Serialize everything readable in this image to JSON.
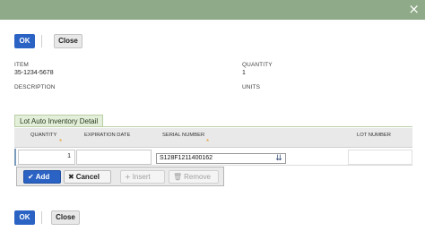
{
  "dialog": {
    "close_glyph": "×",
    "ok_label": "OK",
    "close_label": "Close"
  },
  "item": {
    "item_label": "ITEM",
    "item_value": "35-1234-5678",
    "quantity_label": "QUANTITY",
    "quantity_value": "1",
    "description_label": "DESCRIPTION",
    "units_label": "UNITS"
  },
  "tab": {
    "label": "Lot Auto Inventory Detail"
  },
  "grid": {
    "columns": [
      "QUANTITY",
      "EXPIRATION DATE",
      "SERIAL NUMBER",
      "LOT NUMBER"
    ],
    "required_marker": "*",
    "rows": [
      {
        "quantity": "1",
        "expiration_date": "",
        "serial_number": "S128F1211400162",
        "lot_number": ""
      }
    ]
  },
  "row_actions": {
    "add_label": "Add",
    "cancel_label": "Cancel",
    "insert_label": "Insert",
    "remove_label": "Remove"
  },
  "icons": {
    "close": "close-icon",
    "add": "check-icon",
    "cancel": "x-icon",
    "insert": "plus-icon",
    "remove": "trash-icon",
    "dropdown": "double-chevron-down-icon"
  },
  "colors": {
    "titlebar": "#8faa88",
    "primary": "#2b63c4",
    "required": "#e89b2e",
    "tab_bg": "#e4efd9"
  }
}
